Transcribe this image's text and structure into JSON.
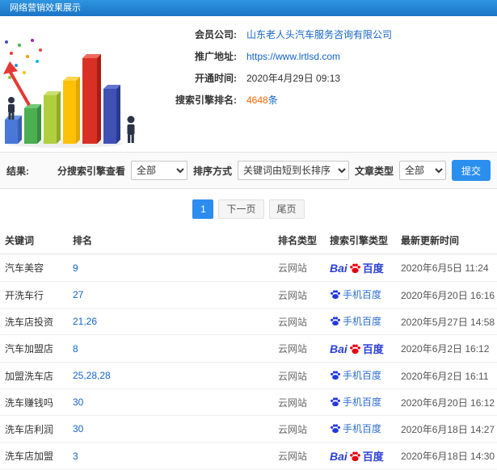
{
  "header": {
    "title": "网络营销效果展示"
  },
  "info": {
    "rows": [
      {
        "label": "会员公司:",
        "value": "山东老人头汽车服务咨询有限公司"
      },
      {
        "label": "推广地址:",
        "value": "https://www.lrtlsd.com"
      },
      {
        "label": "开通时间:",
        "value": "2020年4月29日 09:13"
      },
      {
        "label": "搜索引擎排名:",
        "value_number": "4648",
        "value_unit": "条"
      }
    ]
  },
  "filters": {
    "section_label": "结果:",
    "engine_label": "分搜索引擎查看",
    "engine_value": "全部",
    "sort_label": "排序方式",
    "sort_value": "关键词由短到长排序",
    "article_label": "文章类型",
    "article_value": "全部",
    "submit_label": "提交"
  },
  "pagination": {
    "current": "1",
    "next": "下一页",
    "last": "尾页"
  },
  "table": {
    "headers": [
      "关键词",
      "排名",
      "排名类型",
      "搜索引擎类型",
      "最新更新时间"
    ],
    "engine_labels": {
      "baidu_bai": "Bai",
      "baidu_du": "百度",
      "mobile": "手机百度"
    },
    "rows": [
      {
        "keyword": "汽车美容",
        "rank": "9",
        "rank_type": "云网站",
        "engine": "baidu",
        "updated": "2020年6月5日 11:24"
      },
      {
        "keyword": "开洗车行",
        "rank": "27",
        "rank_type": "云网站",
        "engine": "mobile-baidu",
        "updated": "2020年6月20日 16:16"
      },
      {
        "keyword": "洗车店投资",
        "rank": "21,26",
        "rank_type": "云网站",
        "engine": "mobile-baidu",
        "updated": "2020年5月27日 14:58"
      },
      {
        "keyword": "汽车加盟店",
        "rank": "8",
        "rank_type": "云网站",
        "engine": "baidu",
        "updated": "2020年6月2日 16:12"
      },
      {
        "keyword": "加盟洗车店",
        "rank": "25,28,28",
        "rank_type": "云网站",
        "engine": "mobile-baidu",
        "updated": "2020年6月2日 16:11"
      },
      {
        "keyword": "洗车赚钱吗",
        "rank": "30",
        "rank_type": "云网站",
        "engine": "mobile-baidu",
        "updated": "2020年6月20日 16:12"
      },
      {
        "keyword": "洗车店利润",
        "rank": "30",
        "rank_type": "云网站",
        "engine": "mobile-baidu",
        "updated": "2020年6月18日 14:27"
      },
      {
        "keyword": "洗车店加盟",
        "rank": "3",
        "rank_type": "云网站",
        "engine": "baidu",
        "updated": "2020年6月18日 14:30"
      }
    ]
  },
  "colors": {
    "accent_blue": "#2d8cf0",
    "link_blue": "#1464c8",
    "highlight_orange": "#ff6600",
    "baidu_red": "#e60012",
    "baidu_blue": "#2932e1"
  }
}
